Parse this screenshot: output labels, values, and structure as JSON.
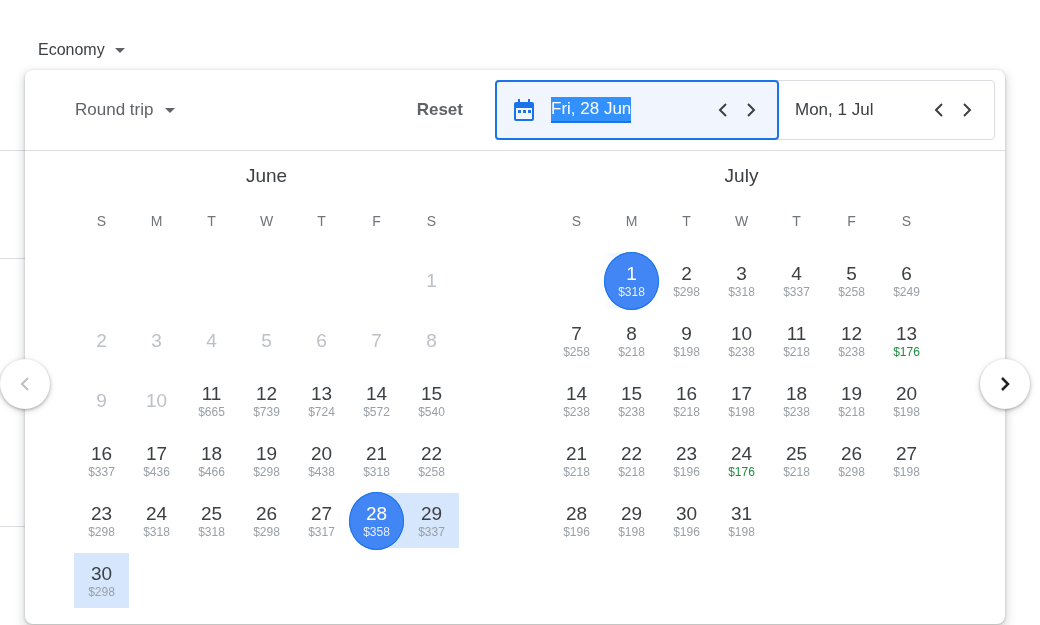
{
  "cabin": {
    "label": "Economy"
  },
  "trip_type": {
    "label": "Round trip"
  },
  "reset": {
    "label": "Reset"
  },
  "date_fields": [
    {
      "value": "Fri, 28 Jun",
      "selected": true
    },
    {
      "value": "Mon, 1 Jul",
      "selected": false
    }
  ],
  "months": [
    {
      "title": "June",
      "weekdays": [
        "S",
        "M",
        "T",
        "W",
        "T",
        "F",
        "S"
      ],
      "weeks": [
        [
          {
            "kind": "blank"
          },
          {
            "kind": "blank"
          },
          {
            "kind": "blank"
          },
          {
            "kind": "blank"
          },
          {
            "kind": "blank"
          },
          {
            "kind": "blank"
          },
          {
            "kind": "day",
            "day": "1",
            "disabled": true,
            "selected": false,
            "in_range": false
          }
        ],
        [
          {
            "kind": "day",
            "day": "2",
            "disabled": true,
            "selected": false,
            "in_range": false
          },
          {
            "kind": "day",
            "day": "3",
            "disabled": true,
            "selected": false,
            "in_range": false
          },
          {
            "kind": "day",
            "day": "4",
            "disabled": true,
            "selected": false,
            "in_range": false
          },
          {
            "kind": "day",
            "day": "5",
            "disabled": true,
            "selected": false,
            "in_range": false
          },
          {
            "kind": "day",
            "day": "6",
            "disabled": true,
            "selected": false,
            "in_range": false
          },
          {
            "kind": "day",
            "day": "7",
            "disabled": true,
            "selected": false,
            "in_range": false
          },
          {
            "kind": "day",
            "day": "8",
            "disabled": true,
            "selected": false,
            "in_range": false
          }
        ],
        [
          {
            "kind": "day",
            "day": "9",
            "disabled": true,
            "selected": false,
            "in_range": false
          },
          {
            "kind": "day",
            "day": "10",
            "disabled": true,
            "selected": false,
            "in_range": false
          },
          {
            "kind": "day",
            "day": "11",
            "price": "$665",
            "disabled": false,
            "cheap": false,
            "selected": false,
            "in_range": false
          },
          {
            "kind": "day",
            "day": "12",
            "price": "$739",
            "disabled": false,
            "cheap": false,
            "selected": false,
            "in_range": false
          },
          {
            "kind": "day",
            "day": "13",
            "price": "$724",
            "disabled": false,
            "cheap": false,
            "selected": false,
            "in_range": false
          },
          {
            "kind": "day",
            "day": "14",
            "price": "$572",
            "disabled": false,
            "cheap": false,
            "selected": false,
            "in_range": false
          },
          {
            "kind": "day",
            "day": "15",
            "price": "$540",
            "disabled": false,
            "cheap": false,
            "selected": false,
            "in_range": false
          }
        ],
        [
          {
            "kind": "day",
            "day": "16",
            "price": "$337",
            "disabled": false,
            "cheap": false,
            "selected": false,
            "in_range": false
          },
          {
            "kind": "day",
            "day": "17",
            "price": "$436",
            "disabled": false,
            "cheap": false,
            "selected": false,
            "in_range": false
          },
          {
            "kind": "day",
            "day": "18",
            "price": "$466",
            "disabled": false,
            "cheap": false,
            "selected": false,
            "in_range": false
          },
          {
            "kind": "day",
            "day": "19",
            "price": "$298",
            "disabled": false,
            "cheap": false,
            "selected": false,
            "in_range": false
          },
          {
            "kind": "day",
            "day": "20",
            "price": "$438",
            "disabled": false,
            "cheap": false,
            "selected": false,
            "in_range": false
          },
          {
            "kind": "day",
            "day": "21",
            "price": "$318",
            "disabled": false,
            "cheap": false,
            "selected": false,
            "in_range": false
          },
          {
            "kind": "day",
            "day": "22",
            "price": "$258",
            "disabled": false,
            "cheap": false,
            "selected": false,
            "in_range": false
          }
        ],
        [
          {
            "kind": "day",
            "day": "23",
            "price": "$298",
            "disabled": false,
            "cheap": false,
            "selected": false,
            "in_range": false
          },
          {
            "kind": "day",
            "day": "24",
            "price": "$318",
            "disabled": false,
            "cheap": false,
            "selected": false,
            "in_range": false
          },
          {
            "kind": "day",
            "day": "25",
            "price": "$318",
            "disabled": false,
            "cheap": false,
            "selected": false,
            "in_range": false
          },
          {
            "kind": "day",
            "day": "26",
            "price": "$298",
            "disabled": false,
            "cheap": false,
            "selected": false,
            "in_range": false
          },
          {
            "kind": "day",
            "day": "27",
            "price": "$317",
            "disabled": false,
            "cheap": false,
            "selected": false,
            "in_range": false
          },
          {
            "kind": "day",
            "day": "28",
            "price": "$358",
            "disabled": false,
            "cheap": false,
            "selected": true,
            "in_range": true
          },
          {
            "kind": "day",
            "day": "29",
            "price": "$337",
            "disabled": false,
            "cheap": false,
            "selected": false,
            "in_range": true
          }
        ],
        [
          {
            "kind": "day",
            "day": "30",
            "price": "$298",
            "disabled": false,
            "cheap": false,
            "selected": false,
            "in_range": true
          }
        ]
      ]
    },
    {
      "title": "July",
      "weekdays": [
        "S",
        "M",
        "T",
        "W",
        "T",
        "F",
        "S"
      ],
      "weeks": [
        [
          {
            "kind": "blank"
          },
          {
            "kind": "day",
            "day": "1",
            "price": "$318",
            "disabled": false,
            "cheap": false,
            "selected": true,
            "in_range": true
          },
          {
            "kind": "day",
            "day": "2",
            "price": "$298",
            "disabled": false,
            "cheap": false,
            "selected": false,
            "in_range": false
          },
          {
            "kind": "day",
            "day": "3",
            "price": "$318",
            "disabled": false,
            "cheap": false,
            "selected": false,
            "in_range": false
          },
          {
            "kind": "day",
            "day": "4",
            "price": "$337",
            "disabled": false,
            "cheap": false,
            "selected": false,
            "in_range": false
          },
          {
            "kind": "day",
            "day": "5",
            "price": "$258",
            "disabled": false,
            "cheap": false,
            "selected": false,
            "in_range": false
          },
          {
            "kind": "day",
            "day": "6",
            "price": "$249",
            "disabled": false,
            "cheap": false,
            "selected": false,
            "in_range": false
          }
        ],
        [
          {
            "kind": "day",
            "day": "7",
            "price": "$258",
            "disabled": false,
            "cheap": false,
            "selected": false,
            "in_range": false
          },
          {
            "kind": "day",
            "day": "8",
            "price": "$218",
            "disabled": false,
            "cheap": false,
            "selected": false,
            "in_range": false
          },
          {
            "kind": "day",
            "day": "9",
            "price": "$198",
            "disabled": false,
            "cheap": false,
            "selected": false,
            "in_range": false
          },
          {
            "kind": "day",
            "day": "10",
            "price": "$238",
            "disabled": false,
            "cheap": false,
            "selected": false,
            "in_range": false
          },
          {
            "kind": "day",
            "day": "11",
            "price": "$218",
            "disabled": false,
            "cheap": false,
            "selected": false,
            "in_range": false
          },
          {
            "kind": "day",
            "day": "12",
            "price": "$238",
            "disabled": false,
            "cheap": false,
            "selected": false,
            "in_range": false
          },
          {
            "kind": "day",
            "day": "13",
            "price": "$176",
            "disabled": false,
            "cheap": true,
            "selected": false,
            "in_range": false
          }
        ],
        [
          {
            "kind": "day",
            "day": "14",
            "price": "$238",
            "disabled": false,
            "cheap": false,
            "selected": false,
            "in_range": false
          },
          {
            "kind": "day",
            "day": "15",
            "price": "$238",
            "disabled": false,
            "cheap": false,
            "selected": false,
            "in_range": false
          },
          {
            "kind": "day",
            "day": "16",
            "price": "$218",
            "disabled": false,
            "cheap": false,
            "selected": false,
            "in_range": false
          },
          {
            "kind": "day",
            "day": "17",
            "price": "$198",
            "disabled": false,
            "cheap": false,
            "selected": false,
            "in_range": false
          },
          {
            "kind": "day",
            "day": "18",
            "price": "$238",
            "disabled": false,
            "cheap": false,
            "selected": false,
            "in_range": false
          },
          {
            "kind": "day",
            "day": "19",
            "price": "$218",
            "disabled": false,
            "cheap": false,
            "selected": false,
            "in_range": false
          },
          {
            "kind": "day",
            "day": "20",
            "price": "$198",
            "disabled": false,
            "cheap": false,
            "selected": false,
            "in_range": false
          }
        ],
        [
          {
            "kind": "day",
            "day": "21",
            "price": "$218",
            "disabled": false,
            "cheap": false,
            "selected": false,
            "in_range": false
          },
          {
            "kind": "day",
            "day": "22",
            "price": "$218",
            "disabled": false,
            "cheap": false,
            "selected": false,
            "in_range": false
          },
          {
            "kind": "day",
            "day": "23",
            "price": "$196",
            "disabled": false,
            "cheap": false,
            "selected": false,
            "in_range": false
          },
          {
            "kind": "day",
            "day": "24",
            "price": "$176",
            "disabled": false,
            "cheap": true,
            "selected": false,
            "in_range": false
          },
          {
            "kind": "day",
            "day": "25",
            "price": "$218",
            "disabled": false,
            "cheap": false,
            "selected": false,
            "in_range": false
          },
          {
            "kind": "day",
            "day": "26",
            "price": "$298",
            "disabled": false,
            "cheap": false,
            "selected": false,
            "in_range": false
          },
          {
            "kind": "day",
            "day": "27",
            "price": "$198",
            "disabled": false,
            "cheap": false,
            "selected": false,
            "in_range": false
          }
        ],
        [
          {
            "kind": "day",
            "day": "28",
            "price": "$196",
            "disabled": false,
            "cheap": false,
            "selected": false,
            "in_range": false
          },
          {
            "kind": "day",
            "day": "29",
            "price": "$198",
            "disabled": false,
            "cheap": false,
            "selected": false,
            "in_range": false
          },
          {
            "kind": "day",
            "day": "30",
            "price": "$196",
            "disabled": false,
            "cheap": false,
            "selected": false,
            "in_range": false
          },
          {
            "kind": "day",
            "day": "31",
            "price": "$198",
            "disabled": false,
            "cheap": false,
            "selected": false,
            "in_range": false
          }
        ]
      ]
    }
  ]
}
